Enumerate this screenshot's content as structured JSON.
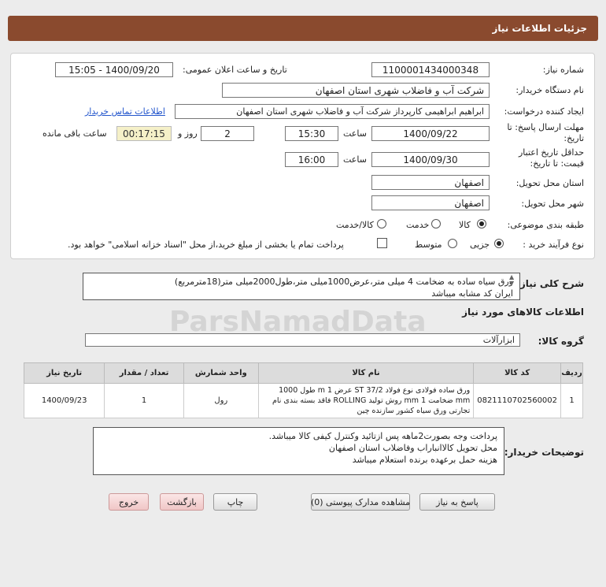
{
  "header": {
    "title": "جزئیات اطلاعات نیاز"
  },
  "form": {
    "need_number_label": "شماره نیاز:",
    "need_number": "1100001434000348",
    "announce_label": "تاریخ و ساعت اعلان عمومی:",
    "announce_value": "1400/09/20 - 15:05",
    "buyer_org_label": "نام دستگاه خریدار:",
    "buyer_org": "شرکت آب و فاضلاب شهری استان اصفهان",
    "creator_label": "ایجاد کننده درخواست:",
    "creator": "ابراهیم ابراهیمی کارپرداز شرکت آب و فاضلاب شهری استان اصفهان",
    "contact_link": "اطلاعات تماس خریدار",
    "deadline_label_1": "مهلت ارسال پاسخ: تا",
    "deadline_label_2": "تاریخ:",
    "deadline_date": "1400/09/22",
    "time_label": "ساعت",
    "deadline_time": "15:30",
    "days_value": "2",
    "days_label": "روز و",
    "remaining_time": "00:17:15",
    "remaining_label": "ساعت باقی مانده",
    "price_validity_label_1": "حداقل تاریخ اعتبار",
    "price_validity_label_2": "قیمت: تا تاریخ:",
    "validity_date": "1400/09/30",
    "validity_time": "16:00",
    "province_label": "استان محل تحویل:",
    "province": "اصفهان",
    "city_label": "شهر محل تحویل:",
    "city": "اصفهان",
    "category_label": "طبقه بندی موضوعی:",
    "category_options": [
      "کالا",
      "خدمت",
      "کالا/خدمت"
    ],
    "purchase_type_label": "نوع فرآیند خرید :",
    "purchase_options": [
      "جزیی",
      "متوسط"
    ],
    "treasury_note": "پرداخت تمام یا بخشی از مبلغ خرید،از محل \"اسناد خزانه اسلامی\" خواهد بود."
  },
  "general_desc": {
    "label": "شرح کلی نیاز:",
    "line1": "ورق سیاه ساده به ضخامت 4 میلی متر،عرض1000میلی متر،طول2000میلی متر(18مترمربع)",
    "line2": "ایران کد مشابه میباشد"
  },
  "goods": {
    "section_title": "اطلاعات کالاهای مورد نیاز",
    "group_label": "گروه کالا:",
    "group_value": "ابزارآلات",
    "columns": [
      "ردیف",
      "کد کالا",
      "نام کالا",
      "واحد شمارش",
      "تعداد / مقدار",
      "تاریخ نیاز"
    ],
    "rows": [
      {
        "index": "1",
        "code": "0821110702560002",
        "name_line1": "ورق ساده فولادی نوع فولاد ST 37/2 عرض 1 m طول 1000",
        "name_line2": "mm ضخامت 1 mm روش تولید ROLLING فاقد بسته بندی نام",
        "name_line3": "تجارتی ورق سیاه کشور سازنده چین",
        "unit": "رول",
        "qty": "1",
        "date": "1400/09/23"
      }
    ]
  },
  "buyer_notes": {
    "label": "توضیحات خریدار:",
    "line1": "پرداخت وجه بصورت2ماهه پس ازتائید وکنترل کیفی کالا میباشد.",
    "line2": "محل تحویل کالاانباراب وفاضلاب استان اصفهان",
    "line3": "هزینه حمل برعهده برنده استعلام میباشد"
  },
  "buttons": {
    "reply": "پاسخ به نیاز",
    "docs": "مشاهده مدارک پیوستی (0)",
    "print": "چاپ",
    "back": "بازگشت",
    "exit": "خروج"
  },
  "watermark": {
    "text": "ParsNamadData"
  }
}
